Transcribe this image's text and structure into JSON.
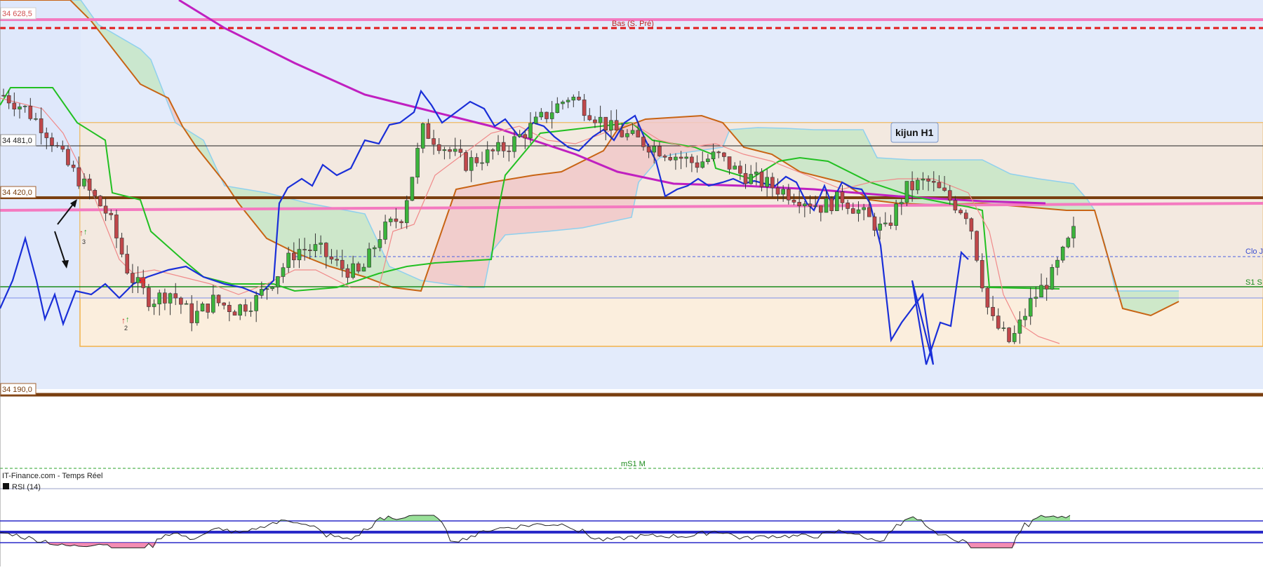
{
  "price_labels": {
    "p1": "34 628,5",
    "p2": "34 481,0",
    "p3": "34 420,0",
    "p4": "34 190,0"
  },
  "annotations": {
    "pivot_low": "Bas (S. Pré)",
    "clo_j": "Clo J",
    "s1_s": "S1 S",
    "ms1_m": "mS1 M",
    "kijun": "kijun H1",
    "source": "IT-Finance.com - Temps Réel",
    "rsi": "RSI (14)",
    "marker_3": "3",
    "marker_2": "2"
  },
  "colors": {
    "background_upper": "#e3ebfb",
    "cloud_bull": "#c6e6c6",
    "cloud_bear": "#f0c8c8",
    "range_box": "#fbeedd",
    "pink_level": "#f47ac0",
    "red_dashed": "#e01b1b",
    "brown_level": "#7a3f10",
    "sma_magenta": "#c020c0",
    "blue_oscillator": "#1a2fd8",
    "kijun_green": "#22c022",
    "senkou_orange": "#c86414",
    "chikou_light": "#8fd0ee",
    "candle_up": "#3cb43c",
    "candle_down": "#c0474a",
    "rsi_line": "#222222",
    "rsi_band": "#2a2ac8"
  },
  "chart_data": {
    "type": "candlestick",
    "instrument_overlays": [
      "Ichimoku",
      "SMA",
      "Pivots"
    ],
    "price_levels": [
      34628.5,
      34481.0,
      34420.0,
      34190.0
    ],
    "close_sample": [
      34540,
      34525,
      34500,
      34460,
      34430,
      34400,
      34330,
      34300,
      34310,
      34280,
      34300,
      34290,
      34300,
      34330,
      34360,
      34360,
      34340,
      34330,
      34380,
      34400,
      34500,
      34480,
      34460,
      34470,
      34480,
      34500,
      34520,
      34540,
      34520,
      34500,
      34490,
      34480,
      34470,
      34460,
      34470,
      34450,
      34440,
      34430,
      34420,
      34410,
      34420,
      34400,
      34380,
      34430,
      34440,
      34420,
      34400,
      34280,
      34250,
      34300,
      34330,
      34380
    ],
    "rsi": {
      "name": "RSI (14)",
      "levels": [
        70,
        50,
        30
      ]
    }
  }
}
